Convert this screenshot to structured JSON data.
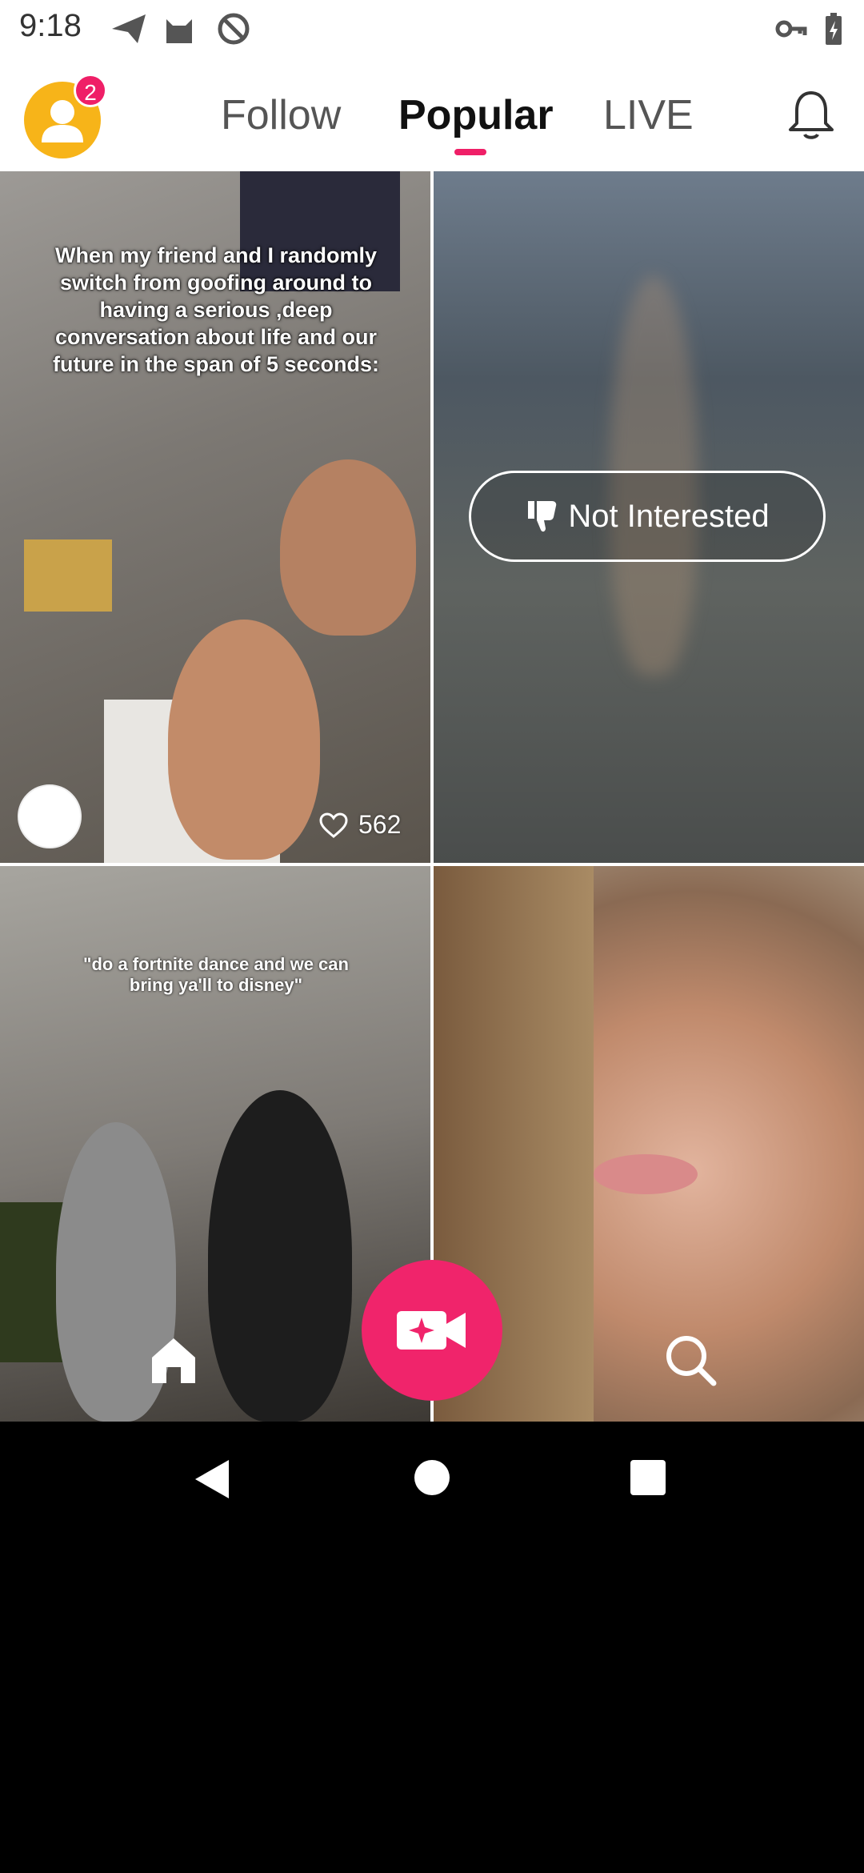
{
  "status_bar": {
    "time": "9:18",
    "left_icons": [
      "send-icon",
      "cat-icon",
      "no-sync-icon"
    ],
    "right_icons": [
      "vpn-key-icon",
      "battery-charging-icon"
    ]
  },
  "header": {
    "notification_count": "2",
    "tabs": [
      {
        "label": "Follow",
        "active": false
      },
      {
        "label": "Popular",
        "active": true
      },
      {
        "label": "LIVE",
        "active": false
      }
    ],
    "accent_color": "#ef1f67"
  },
  "feed": {
    "items": [
      {
        "overlay_text": "When my friend and I randomly switch from goofing around to having a serious ,deep conversation about life and our future in the span of 5 seconds:",
        "likes": "562"
      },
      {
        "action_label": "Not Interested"
      },
      {
        "overlay_text": "\"do a fortnite dance and we can bring ya'll to disney\""
      },
      {}
    ]
  },
  "bottom_nav": {
    "items": [
      "home-icon",
      "create-video-icon",
      "search-icon"
    ]
  },
  "system_nav": [
    "back-icon",
    "home-circle-icon",
    "recents-icon"
  ]
}
